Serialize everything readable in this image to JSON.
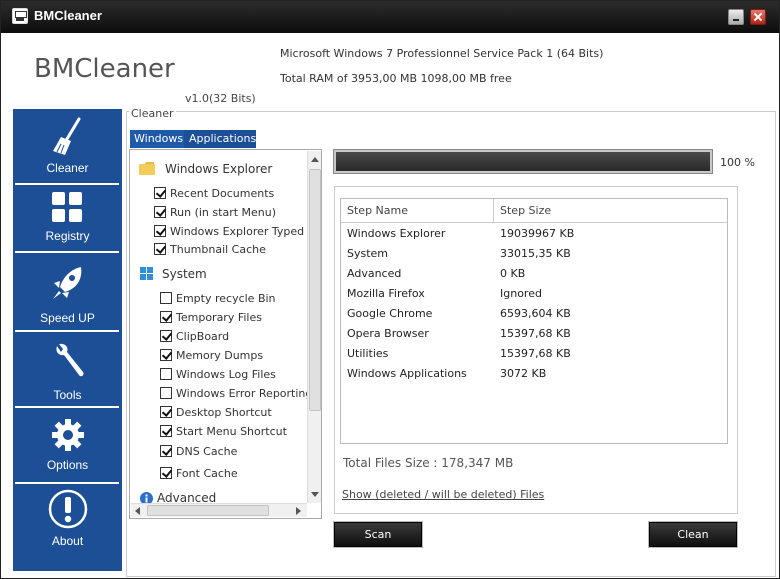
{
  "window": {
    "title": "BMCleaner"
  },
  "header": {
    "brand": "BMCleaner",
    "version": "v1.0(32 Bits)",
    "os_info": "Microsoft Windows 7 Professionnel Service Pack 1 (64 Bits)",
    "ram_info": "Total RAM of 3953,00 MB 1098,00 MB free"
  },
  "sidebar": {
    "items": [
      {
        "label": "Cleaner",
        "icon": "broom-icon"
      },
      {
        "label": "Registry",
        "icon": "grid-icon"
      },
      {
        "label": "Speed UP",
        "icon": "rocket-icon"
      },
      {
        "label": "Tools",
        "icon": "wrench-icon"
      },
      {
        "label": "Options",
        "icon": "gear-icon"
      },
      {
        "label": "About",
        "icon": "exclamation-icon"
      }
    ]
  },
  "cleaner": {
    "group_label": "Cleaner",
    "tabs": [
      {
        "label": "Windows",
        "active": true
      },
      {
        "label": "Applications",
        "active": false
      }
    ],
    "tree": {
      "categories": [
        {
          "name": "Windows Explorer",
          "icon": "folder-icon",
          "items": [
            {
              "label": "Recent Documents",
              "checked": true
            },
            {
              "label": "Run (in start Menu)",
              "checked": true
            },
            {
              "label": "Windows Explorer Typed P",
              "checked": true
            },
            {
              "label": "Thumbnail Cache",
              "checked": true
            }
          ]
        },
        {
          "name": "System",
          "icon": "windows-logo-icon",
          "items": [
            {
              "label": "Empty recycle Bin",
              "checked": false
            },
            {
              "label": "Temporary Files",
              "checked": true
            },
            {
              "label": "ClipBoard",
              "checked": true
            },
            {
              "label": "Memory Dumps",
              "checked": true
            },
            {
              "label": "Windows Log Files",
              "checked": false
            },
            {
              "label": "Windows Error Reporting",
              "checked": false
            },
            {
              "label": "Desktop Shortcut",
              "checked": true
            },
            {
              "label": "Start Menu Shortcut",
              "checked": true
            },
            {
              "label": "DNS Cache",
              "checked": true
            },
            {
              "label": "Font Cache",
              "checked": true
            }
          ]
        },
        {
          "name": "Advanced",
          "icon": "info-icon",
          "items": []
        }
      ]
    },
    "progress": {
      "percent": 100,
      "label": "100 %"
    },
    "results": {
      "columns": [
        "Step Name",
        "Step Size"
      ],
      "rows": [
        [
          "Windows Explorer",
          "19039967 KB"
        ],
        [
          "System",
          "33015,35 KB"
        ],
        [
          "Advanced",
          "0 KB"
        ],
        [
          "Mozilla Firefox",
          "Ignored"
        ],
        [
          "Google Chrome",
          "6593,604 KB"
        ],
        [
          "Opera Browser",
          "15397,68 KB"
        ],
        [
          "Utilities",
          "15397,68 KB"
        ],
        [
          "Windows Applications",
          "3072 KB"
        ]
      ]
    },
    "total": "Total Files Size : 178,347 MB",
    "show_link": "Show (deleted / will be deleted) Files",
    "scan_label": "Scan",
    "clean_label": "Clean"
  }
}
